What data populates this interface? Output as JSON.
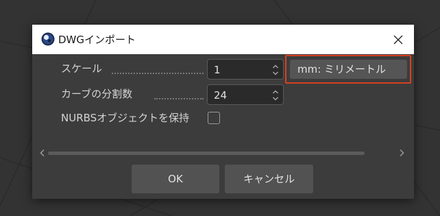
{
  "dialog": {
    "title": "DWGインポート",
    "close_icon": "close-icon",
    "app_icon": "cinema4d-logo-icon"
  },
  "options": {
    "scale": {
      "label": "スケール",
      "value": "1"
    },
    "curve_subdivisions": {
      "label": "カーブの分割数",
      "value": "24"
    },
    "keep_nurbs": {
      "label": "NURBSオブジェクトを保持",
      "checked": false
    },
    "unit": {
      "label": "mm: ミリメートル",
      "highlight_color": "#d8401f"
    }
  },
  "buttons": {
    "ok": "OK",
    "cancel": "キャンセル"
  },
  "colors": {
    "background": "#333333",
    "dialog": "#3c3c3c",
    "titlebar": "#ffffff",
    "button": "#525252"
  }
}
